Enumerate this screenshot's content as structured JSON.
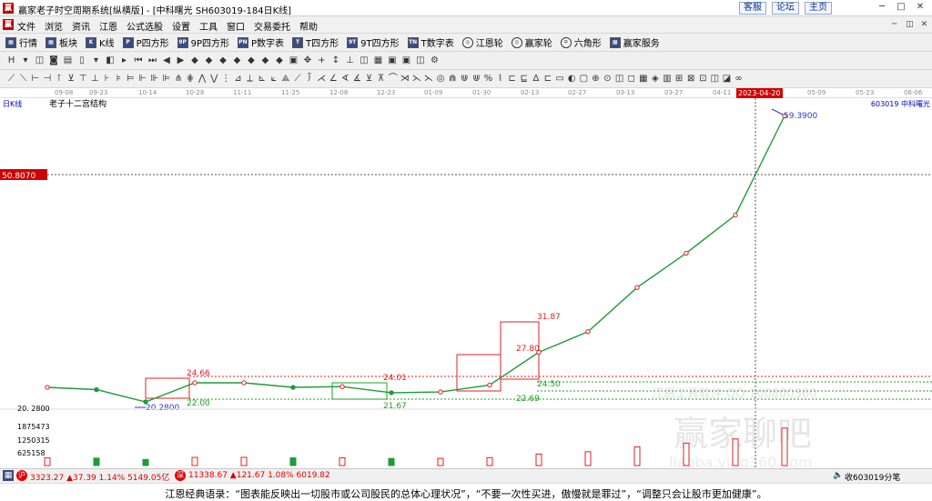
{
  "window": {
    "title": "赢家老子时空周期系统[纵横版] - [中科曙光  SH603019-184日K线]",
    "service_btn": "客服",
    "forum_btn": "论坛",
    "home_btn": "主页"
  },
  "menu": [
    "文件",
    "浏览",
    "资讯",
    "江恩",
    "公式选股",
    "设置",
    "工具",
    "窗口",
    "交易委托",
    "帮助"
  ],
  "toolbar1": [
    {
      "icon": "grid-icon",
      "glyph": "▦",
      "label": "行情"
    },
    {
      "icon": "grid-icon",
      "glyph": "▦",
      "label": "板块"
    },
    {
      "icon": "candle-icon",
      "glyph": "K",
      "label": "K线"
    },
    {
      "icon": "p-square-icon",
      "glyph": "P",
      "label": "P四方形"
    },
    {
      "icon": "9p-square-icon",
      "glyph": "9P",
      "label": "9P四方形"
    },
    {
      "icon": "pn-table-icon",
      "glyph": "PN",
      "label": "P数字表"
    },
    {
      "icon": "t-square-icon",
      "glyph": "T",
      "label": "T四方形"
    },
    {
      "icon": "9t-square-icon",
      "glyph": "9T",
      "label": "9T四方形"
    },
    {
      "icon": "tn-table-icon",
      "glyph": "TN",
      "label": "T数字表"
    },
    {
      "icon": "gann-wheel-icon",
      "glyph": "◎",
      "label": "江恩轮"
    },
    {
      "icon": "winner-wheel-icon",
      "glyph": "◎",
      "label": "赢家轮"
    },
    {
      "icon": "hexagon-icon",
      "glyph": "✡",
      "label": "六角形"
    },
    {
      "icon": "service-icon",
      "glyph": "▦",
      "label": "赢家服务"
    }
  ],
  "toolbar2_glyphs": [
    "H",
    "▾",
    "◫",
    "◙",
    "▤",
    "▯",
    "▾",
    "◧",
    "▸",
    "⏮",
    "⏭",
    "◀",
    "▶",
    "◆",
    "◆",
    "◆",
    "◆",
    "◆",
    "◆",
    "◆",
    "▣",
    "✥",
    "+",
    "↕",
    "⊥",
    "◫",
    "▦",
    "▣",
    "▣",
    "◫",
    "⚙"
  ],
  "toolbar3_glyphs": [
    "⟋",
    "⟍",
    "⊢",
    "⊣",
    "⊺",
    "⊻",
    "⊤",
    "⊥",
    "⊦",
    "⊧",
    "⊨",
    "⊩",
    "⊪",
    "⊫",
    "⋔",
    "⋕",
    "⋀",
    "⋁",
    "⋮",
    "⊿",
    "⟂",
    "⊾",
    "⟀",
    "⟁",
    "⟋",
    "⟌",
    "⋌",
    "∠",
    "∢",
    "∡",
    "⊻",
    "⊼",
    "⌒",
    "⋊",
    "⋋",
    "⋋",
    "◎",
    "⋒",
    "⋓",
    "⋓",
    "%",
    "⌇",
    "⊏",
    "⊑",
    "Δ",
    "⊏",
    "▭",
    "◐",
    "▢",
    "⊕",
    "⊙",
    "◫",
    "◻",
    "▦",
    "◈",
    "▥",
    "⊞",
    "⊠",
    "⊡",
    "◫",
    "◪",
    "∞"
  ],
  "chart": {
    "period_label": "日K线",
    "indicator_title": "老子十二宫结构",
    "stock_code_name": "603019  中科曙光",
    "cursor_price": "50.8070",
    "high_label": "59.3900",
    "low_label": "20.2800",
    "axis_price_left": "20. 2800",
    "volume_labels": [
      "1875473",
      "1250315",
      "625158"
    ],
    "box_labels": [
      "24.66",
      "22.00",
      "24.01",
      "21.67",
      "31.87",
      "27.80",
      "24.50",
      "22.69"
    ],
    "watermark_1": "江恩工具软件  QQ:100800360",
    "watermark_2": "赢家聊吧",
    "watermark_3": "liaoba.ying360.com",
    "date_ticks": [
      "09-08",
      "09-23",
      "10-14",
      "10-28",
      "11-11",
      "11-25",
      "12-08",
      "12-23",
      "01-09",
      "01-30",
      "02-13",
      "02-27",
      "03-13",
      "03-27",
      "04-11",
      "2023-04-20",
      "05-09",
      "05-23",
      "06-06"
    ]
  },
  "chart_data": {
    "type": "line",
    "title": "老子十二宫结构",
    "xlabel": "",
    "ylabel": "",
    "x": [
      "09-08",
      "09-23",
      "10-14",
      "10-28",
      "11-11",
      "11-25",
      "12-08",
      "12-23",
      "01-09",
      "01-30",
      "02-13",
      "02-27",
      "03-13",
      "03-27",
      "04-11",
      "2023-04-20"
    ],
    "series": [
      {
        "values": [
          22.9,
          22.6,
          21.0,
          23.5,
          23.5,
          22.9,
          23.0,
          22.2,
          22.3,
          23.2,
          27.5,
          30.2,
          36.0,
          40.5,
          45.5,
          58.5
        ]
      }
    ],
    "annotations": {
      "high": 59.39,
      "low": 20.28,
      "cursor": 50.807,
      "cursor_date": "2023-04-20"
    },
    "ylim": [
      20.28,
      59.39
    ]
  },
  "status": {
    "sh_icon": "沪",
    "sh_text": "3323.27 ▲37.39 1.14% 5149.05亿",
    "sz_icon": "深",
    "sz_text": "11338.67 ▲121.67 1.08% 6019.82",
    "right_text": "收603019分笔"
  },
  "footer": {
    "quote": "江恩经典语录：“图表能反映出一切股市或公司股民的总体心理状况”，“不要一次性买进，傲慢就是罪过”，“调整只会让股市更加健康”。"
  }
}
